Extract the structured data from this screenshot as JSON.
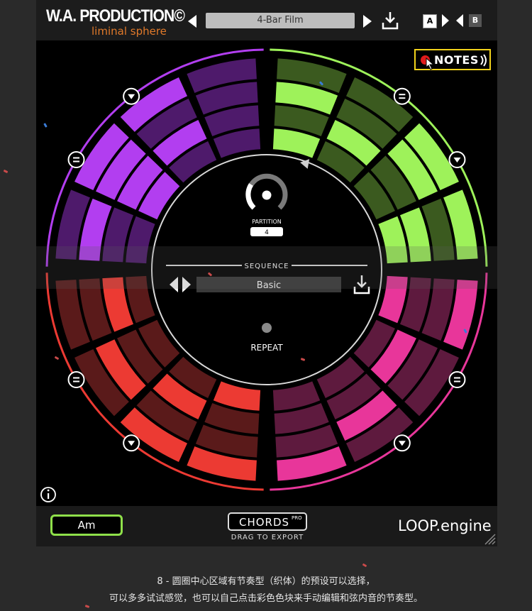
{
  "header": {
    "brand_title": "W.A. PRODUCTION©",
    "brand_subtitle": "liminal sphere",
    "preset_name": "4-Bar Film",
    "ab_a": "A",
    "ab_b": "B"
  },
  "notes_button": {
    "label": "NOTES"
  },
  "center": {
    "partition_label": "PARTITION",
    "partition_value": "4",
    "sequence_label": "SEQUENCE",
    "sequence_value": "Basic",
    "repeat_label": "REPEAT"
  },
  "footer": {
    "key_value": "Am",
    "chords_label": "CHORDS",
    "chords_badge": "PRO",
    "drag_label": "DRAG TO EXPORT",
    "product_label": "LOOP.engine"
  },
  "caption": {
    "line1": "8 - 圆圈中心区域有节奏型（织体）的预设可以选择，",
    "line2": "可以多多试试感觉，也可以自己点击彩色色块来手动编辑和弦内音的节奏型。"
  },
  "colors": {
    "purple_bright": "#b23ef0",
    "purple_dim": "#4e1a6b",
    "green_bright": "#9ef25a",
    "green_dim": "#3b5a1f",
    "pink_bright": "#e8369a",
    "pink_dim": "#5e1a3e",
    "red_bright": "#ec3a33",
    "red_dim": "#5a1a1a",
    "accent_yellow": "#f2d21b",
    "key_green": "#8fe04a",
    "brand_orange": "#e0792a"
  },
  "quadrants": [
    {
      "name": "purple",
      "lit": [
        [
          0,
          1,
          0,
          0
        ],
        [
          0,
          1,
          1,
          0
        ],
        [
          1,
          1,
          0,
          0
        ],
        [
          0,
          1,
          1,
          0
        ]
      ]
    },
    {
      "name": "green",
      "lit": [
        [
          1,
          0,
          0,
          1
        ],
        [
          0,
          1,
          0,
          1
        ],
        [
          1,
          0,
          1,
          0
        ],
        [
          0,
          0,
          1,
          1
        ]
      ]
    },
    {
      "name": "pink",
      "lit": [
        [
          1,
          0,
          0,
          0
        ],
        [
          0,
          1,
          0,
          0
        ],
        [
          0,
          0,
          1,
          0
        ],
        [
          1,
          0,
          0,
          1
        ]
      ]
    },
    {
      "name": "red",
      "lit": [
        [
          1,
          0,
          0,
          0
        ],
        [
          0,
          1,
          0,
          1
        ],
        [
          0,
          0,
          1,
          0
        ],
        [
          1,
          1,
          0,
          0
        ]
      ]
    }
  ]
}
